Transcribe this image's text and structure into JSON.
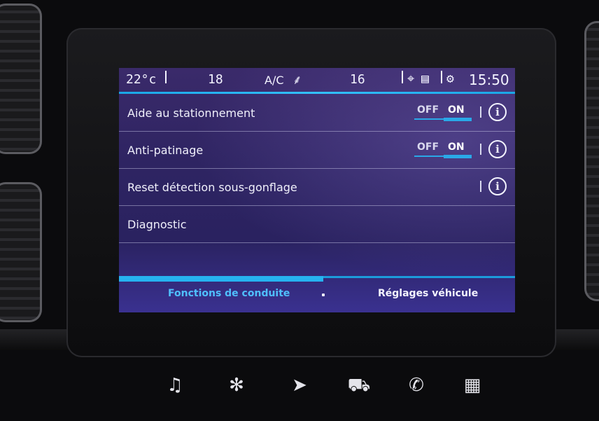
{
  "status": {
    "temp_left": "22°c",
    "fan_left": "18",
    "ac": "A/C",
    "fan_right": "16",
    "clock": "15:50"
  },
  "settings": [
    {
      "label": "Aide au stationnement",
      "toggle": {
        "off": "OFF",
        "on": "ON",
        "state": "ON"
      }
    },
    {
      "label": "Anti-patinage",
      "toggle": {
        "off": "OFF",
        "on": "ON",
        "state": "ON"
      }
    },
    {
      "label": "Reset détection sous-gonflage"
    },
    {
      "label": "Diagnostic"
    }
  ],
  "tabs": [
    {
      "label": "Fonctions de conduite",
      "active": true
    },
    {
      "label": "Réglages véhicule",
      "active": false
    }
  ],
  "hardkeys": [
    {
      "icon": "music-icon",
      "glyph": "♫"
    },
    {
      "icon": "fan-icon",
      "glyph": "✻"
    },
    {
      "icon": "navigation-icon",
      "glyph": "➤"
    },
    {
      "icon": "car-icon",
      "glyph": "⛟"
    },
    {
      "icon": "phone-icon",
      "glyph": "✆"
    },
    {
      "icon": "apps-grid-icon",
      "glyph": "▦"
    }
  ],
  "colors": {
    "accent": "#26b2f0",
    "screen_bg": "#2e2462",
    "text": "#f0f0fb"
  }
}
